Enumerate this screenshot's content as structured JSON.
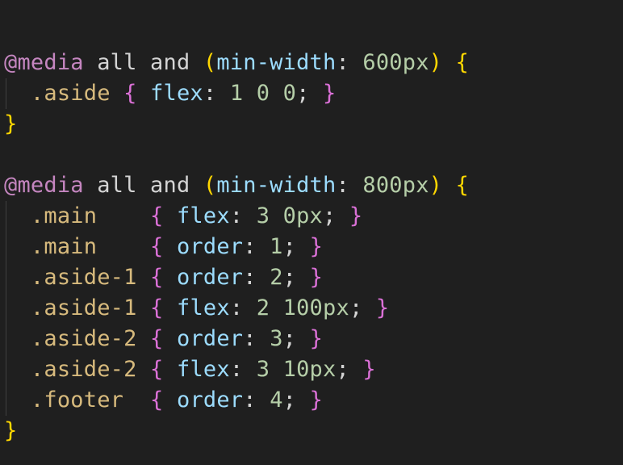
{
  "colors": {
    "background": "#1f1f1f",
    "at_rule": "#c586c0",
    "keyword": "#d4d4d4",
    "media_feature": "#9cdcfe",
    "number": "#b5cea8",
    "selector": "#d7ba7d",
    "property": "#9cdcfe",
    "text": "#d4d4d4",
    "bracket_level1": "#ffd700",
    "bracket_level2": "#da70d6",
    "indent_guide": "#404040"
  },
  "lines": [
    {
      "tokens": [
        {
          "t": "@media",
          "c": "at_rule"
        },
        {
          "t": " ",
          "c": "text"
        },
        {
          "t": "all",
          "c": "keyword"
        },
        {
          "t": " ",
          "c": "text"
        },
        {
          "t": "and",
          "c": "keyword"
        },
        {
          "t": " ",
          "c": "text"
        },
        {
          "t": "(",
          "c": "bracket_level1"
        },
        {
          "t": "min-width",
          "c": "media_feature"
        },
        {
          "t": ": ",
          "c": "text"
        },
        {
          "t": "600px",
          "c": "number"
        },
        {
          "t": ")",
          "c": "bracket_level1"
        },
        {
          "t": " ",
          "c": "text"
        },
        {
          "t": "{",
          "c": "bracket_level1"
        }
      ]
    },
    {
      "tokens": [
        {
          "t": "  ",
          "c": "text"
        },
        {
          "t": ".aside",
          "c": "selector"
        },
        {
          "t": " ",
          "c": "text"
        },
        {
          "t": "{",
          "c": "bracket_level2"
        },
        {
          "t": " ",
          "c": "text"
        },
        {
          "t": "flex",
          "c": "property"
        },
        {
          "t": ": ",
          "c": "text"
        },
        {
          "t": "1 0 0",
          "c": "number"
        },
        {
          "t": "; ",
          "c": "text"
        },
        {
          "t": "}",
          "c": "bracket_level2"
        }
      ]
    },
    {
      "tokens": [
        {
          "t": "}",
          "c": "bracket_level1"
        }
      ]
    },
    {
      "tokens": []
    },
    {
      "tokens": [
        {
          "t": "@media",
          "c": "at_rule"
        },
        {
          "t": " ",
          "c": "text"
        },
        {
          "t": "all",
          "c": "keyword"
        },
        {
          "t": " ",
          "c": "text"
        },
        {
          "t": "and",
          "c": "keyword"
        },
        {
          "t": " ",
          "c": "text"
        },
        {
          "t": "(",
          "c": "bracket_level1"
        },
        {
          "t": "min-width",
          "c": "media_feature"
        },
        {
          "t": ": ",
          "c": "text"
        },
        {
          "t": "800px",
          "c": "number"
        },
        {
          "t": ")",
          "c": "bracket_level1"
        },
        {
          "t": " ",
          "c": "text"
        },
        {
          "t": "{",
          "c": "bracket_level1"
        }
      ]
    },
    {
      "tokens": [
        {
          "t": "  ",
          "c": "text"
        },
        {
          "t": ".main",
          "c": "selector"
        },
        {
          "t": "    ",
          "c": "text"
        },
        {
          "t": "{",
          "c": "bracket_level2"
        },
        {
          "t": " ",
          "c": "text"
        },
        {
          "t": "flex",
          "c": "property"
        },
        {
          "t": ": ",
          "c": "text"
        },
        {
          "t": "3 0px",
          "c": "number"
        },
        {
          "t": "; ",
          "c": "text"
        },
        {
          "t": "}",
          "c": "bracket_level2"
        }
      ]
    },
    {
      "tokens": [
        {
          "t": "  ",
          "c": "text"
        },
        {
          "t": ".main",
          "c": "selector"
        },
        {
          "t": "    ",
          "c": "text"
        },
        {
          "t": "{",
          "c": "bracket_level2"
        },
        {
          "t": " ",
          "c": "text"
        },
        {
          "t": "order",
          "c": "property"
        },
        {
          "t": ": ",
          "c": "text"
        },
        {
          "t": "1",
          "c": "number"
        },
        {
          "t": "; ",
          "c": "text"
        },
        {
          "t": "}",
          "c": "bracket_level2"
        }
      ]
    },
    {
      "tokens": [
        {
          "t": "  ",
          "c": "text"
        },
        {
          "t": ".aside-1",
          "c": "selector"
        },
        {
          "t": " ",
          "c": "text"
        },
        {
          "t": "{",
          "c": "bracket_level2"
        },
        {
          "t": " ",
          "c": "text"
        },
        {
          "t": "order",
          "c": "property"
        },
        {
          "t": ": ",
          "c": "text"
        },
        {
          "t": "2",
          "c": "number"
        },
        {
          "t": "; ",
          "c": "text"
        },
        {
          "t": "}",
          "c": "bracket_level2"
        }
      ]
    },
    {
      "tokens": [
        {
          "t": "  ",
          "c": "text"
        },
        {
          "t": ".aside-1",
          "c": "selector"
        },
        {
          "t": " ",
          "c": "text"
        },
        {
          "t": "{",
          "c": "bracket_level2"
        },
        {
          "t": " ",
          "c": "text"
        },
        {
          "t": "flex",
          "c": "property"
        },
        {
          "t": ": ",
          "c": "text"
        },
        {
          "t": "2 100px",
          "c": "number"
        },
        {
          "t": "; ",
          "c": "text"
        },
        {
          "t": "}",
          "c": "bracket_level2"
        }
      ]
    },
    {
      "tokens": [
        {
          "t": "  ",
          "c": "text"
        },
        {
          "t": ".aside-2",
          "c": "selector"
        },
        {
          "t": " ",
          "c": "text"
        },
        {
          "t": "{",
          "c": "bracket_level2"
        },
        {
          "t": " ",
          "c": "text"
        },
        {
          "t": "order",
          "c": "property"
        },
        {
          "t": ": ",
          "c": "text"
        },
        {
          "t": "3",
          "c": "number"
        },
        {
          "t": "; ",
          "c": "text"
        },
        {
          "t": "}",
          "c": "bracket_level2"
        }
      ]
    },
    {
      "tokens": [
        {
          "t": "  ",
          "c": "text"
        },
        {
          "t": ".aside-2",
          "c": "selector"
        },
        {
          "t": " ",
          "c": "text"
        },
        {
          "t": "{",
          "c": "bracket_level2"
        },
        {
          "t": " ",
          "c": "text"
        },
        {
          "t": "flex",
          "c": "property"
        },
        {
          "t": ": ",
          "c": "text"
        },
        {
          "t": "3 10px",
          "c": "number"
        },
        {
          "t": "; ",
          "c": "text"
        },
        {
          "t": "}",
          "c": "bracket_level2"
        }
      ]
    },
    {
      "tokens": [
        {
          "t": "  ",
          "c": "text"
        },
        {
          "t": ".footer",
          "c": "selector"
        },
        {
          "t": "  ",
          "c": "text"
        },
        {
          "t": "{",
          "c": "bracket_level2"
        },
        {
          "t": " ",
          "c": "text"
        },
        {
          "t": "order",
          "c": "property"
        },
        {
          "t": ": ",
          "c": "text"
        },
        {
          "t": "4",
          "c": "number"
        },
        {
          "t": "; ",
          "c": "text"
        },
        {
          "t": "}",
          "c": "bracket_level2"
        }
      ]
    },
    {
      "tokens": [
        {
          "t": "}",
          "c": "bracket_level1"
        }
      ]
    }
  ]
}
